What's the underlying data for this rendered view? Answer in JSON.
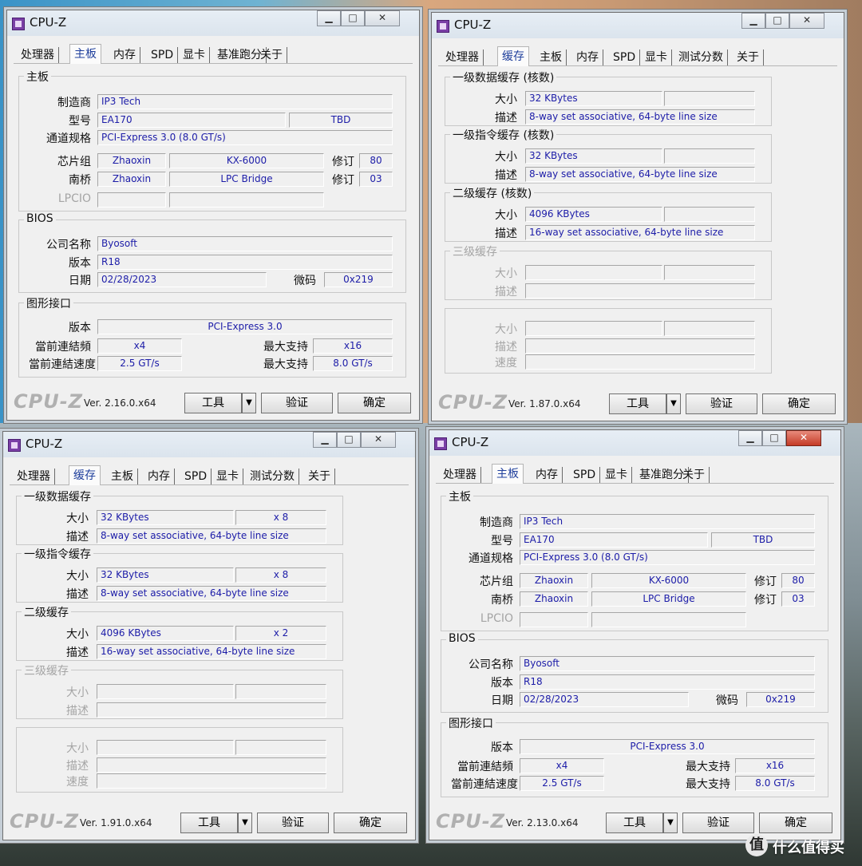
{
  "watermark": {
    "icon": "值",
    "text": "什么值得买"
  },
  "windows": {
    "tl": {
      "title": "CPU-Z",
      "tabs": [
        "处理器",
        "主板",
        "内存",
        "SPD",
        "显卡",
        "基准跑分",
        "关于"
      ],
      "selected_tab": "主板",
      "motherboard": {
        "group_title": "主板",
        "manufacturer_label": "制造商",
        "manufacturer": "IP3 Tech",
        "model_label": "型号",
        "model": "EA170",
        "model_rev": "TBD",
        "bus_label": "通道规格",
        "bus": "PCI-Express 3.0 (8.0 GT/s)",
        "chipset_label": "芯片组",
        "chipset_vendor": "Zhaoxin",
        "chipset": "KX-6000",
        "rev_label": "修订",
        "chipset_rev": "80",
        "south_label": "南桥",
        "south_vendor": "Zhaoxin",
        "south": "LPC Bridge",
        "south_rev": "03",
        "lpcio_label": "LPCIO"
      },
      "bios": {
        "group_title": "BIOS",
        "brand_label": "公司名称",
        "brand": "Byosoft",
        "version_label": "版本",
        "version": "R18",
        "date_label": "日期",
        "date": "02/28/2023",
        "microcode_label": "微码",
        "microcode": "0x219"
      },
      "graphic": {
        "group_title": "图形接口",
        "version_label": "版本",
        "version": "PCI-Express 3.0",
        "link_width_label": "當前連結頻",
        "link_width": "x4",
        "max_label": "最大支持",
        "max_width": "x16",
        "link_speed_label": "當前連結速度",
        "link_speed": "2.5 GT/s",
        "max_speed": "8.0 GT/s"
      },
      "footer": {
        "brand": "CPU-Z",
        "version": "Ver. 2.16.0.x64",
        "tools": "工具",
        "validate": "验证",
        "ok": "确定"
      }
    },
    "tr": {
      "title": "CPU-Z",
      "tabs": [
        "处理器",
        "缓存",
        "主板",
        "内存",
        "SPD",
        "显卡",
        "测试分数",
        "关于"
      ],
      "selected_tab": "缓存",
      "l1d": {
        "title": "一级数据缓存 (核数)",
        "size_label": "大小",
        "size": "32 KBytes",
        "count": "",
        "desc_label": "描述",
        "desc": "8-way set associative, 64-byte line size"
      },
      "l1i": {
        "title": "一级指令缓存 (核数)",
        "size_label": "大小",
        "size": "32 KBytes",
        "count": "",
        "desc_label": "描述",
        "desc": "8-way set associative, 64-byte line size"
      },
      "l2": {
        "title": "二级缓存 (核数)",
        "size_label": "大小",
        "size": "4096 KBytes",
        "count": "",
        "desc_label": "描述",
        "desc": "16-way set associative, 64-byte line size"
      },
      "l3": {
        "title": "三级缓存",
        "size_label": "大小",
        "desc_label": "描述"
      },
      "extra": {
        "size_label": "大小",
        "desc_label": "描述",
        "speed_label": "速度"
      },
      "footer": {
        "brand": "CPU-Z",
        "version": "Ver. 1.87.0.x64",
        "tools": "工具",
        "validate": "验证",
        "ok": "确定"
      }
    },
    "bl": {
      "title": "CPU-Z",
      "tabs": [
        "处理器",
        "缓存",
        "主板",
        "内存",
        "SPD",
        "显卡",
        "测试分数",
        "关于"
      ],
      "selected_tab": "缓存",
      "l1d": {
        "title": "一级数据缓存",
        "size_label": "大小",
        "size": "32 KBytes",
        "count": "x 8",
        "desc_label": "描述",
        "desc": "8-way set associative, 64-byte line size"
      },
      "l1i": {
        "title": "一级指令缓存",
        "size_label": "大小",
        "size": "32 KBytes",
        "count": "x 8",
        "desc_label": "描述",
        "desc": "8-way set associative, 64-byte line size"
      },
      "l2": {
        "title": "二级缓存",
        "size_label": "大小",
        "size": "4096 KBytes",
        "count": "x 2",
        "desc_label": "描述",
        "desc": "16-way set associative, 64-byte line size"
      },
      "l3": {
        "title": "三级缓存",
        "size_label": "大小",
        "desc_label": "描述"
      },
      "extra": {
        "size_label": "大小",
        "desc_label": "描述",
        "speed_label": "速度"
      },
      "footer": {
        "brand": "CPU-Z",
        "version": "Ver. 1.91.0.x64",
        "tools": "工具",
        "validate": "验证",
        "ok": "确定"
      }
    },
    "br": {
      "title": "CPU-Z",
      "tabs": [
        "处理器",
        "主板",
        "内存",
        "SPD",
        "显卡",
        "基准跑分",
        "关于"
      ],
      "selected_tab": "主板",
      "motherboard": {
        "group_title": "主板",
        "manufacturer_label": "制造商",
        "manufacturer": "IP3 Tech",
        "model_label": "型号",
        "model": "EA170",
        "model_rev": "TBD",
        "bus_label": "通道规格",
        "bus": "PCI-Express 3.0 (8.0 GT/s)",
        "chipset_label": "芯片组",
        "chipset_vendor": "Zhaoxin",
        "chipset": "KX-6000",
        "rev_label": "修订",
        "chipset_rev": "80",
        "south_label": "南桥",
        "south_vendor": "Zhaoxin",
        "south": "LPC Bridge",
        "south_rev": "03",
        "lpcio_label": "LPCIO"
      },
      "bios": {
        "group_title": "BIOS",
        "brand_label": "公司名称",
        "brand": "Byosoft",
        "version_label": "版本",
        "version": "R18",
        "date_label": "日期",
        "date": "02/28/2023",
        "microcode_label": "微码",
        "microcode": "0x219"
      },
      "graphic": {
        "group_title": "图形接口",
        "version_label": "版本",
        "version": "PCI-Express 3.0",
        "link_width_label": "當前連結頻",
        "link_width": "x4",
        "max_label": "最大支持",
        "max_width": "x16",
        "link_speed_label": "當前連結速度",
        "link_speed": "2.5 GT/s",
        "max_speed": "8.0 GT/s"
      },
      "footer": {
        "brand": "CPU-Z",
        "version": "Ver. 2.13.0.x64",
        "tools": "工具",
        "validate": "验证",
        "ok": "确定"
      }
    }
  }
}
